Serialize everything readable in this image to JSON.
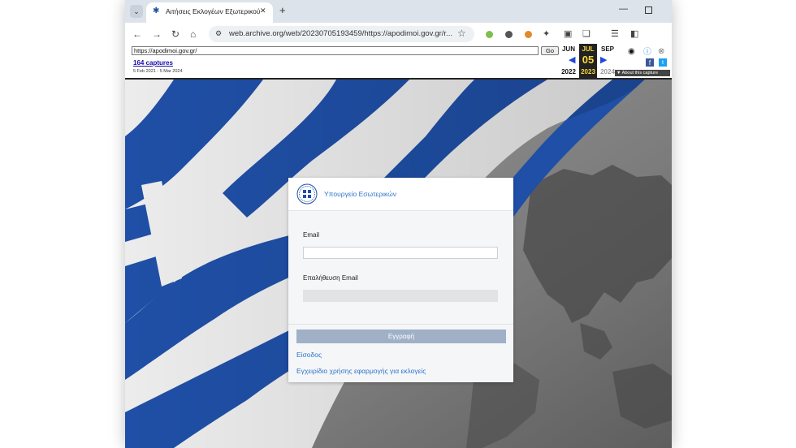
{
  "browser": {
    "tab_title": "Αιτήσεις Εκλογέων Εξωτερικού",
    "url": "web.archive.org/web/20230705193459/https://apodimoi.gov.gr/r..."
  },
  "wayback": {
    "url_input": "https://apodimoi.gov.gr/",
    "go_label": "Go",
    "captures": "164 captures",
    "date_range": "5 Feb 2021 - 5 Mar 2024",
    "months": [
      "JUN",
      "JUL",
      "SEP"
    ],
    "day": "05",
    "years": [
      "2022",
      "2023",
      "2024"
    ],
    "about_label": "▼ About this capture"
  },
  "page": {
    "ministry_name": "Υπουργείο Εσωτερικών",
    "email_label": "Email",
    "confirm_email_label": "Επαλήθευση Email",
    "register_button": "Εγγραφή",
    "login_link": "Είσοδος",
    "manual_link": "Εγχειρίδιο χρήσης εφαρμογής για εκλογείς"
  },
  "colors": {
    "flag_blue": "#1f4fa6",
    "link_blue": "#2e74c9",
    "button_disabled": "#9fb0c7"
  }
}
